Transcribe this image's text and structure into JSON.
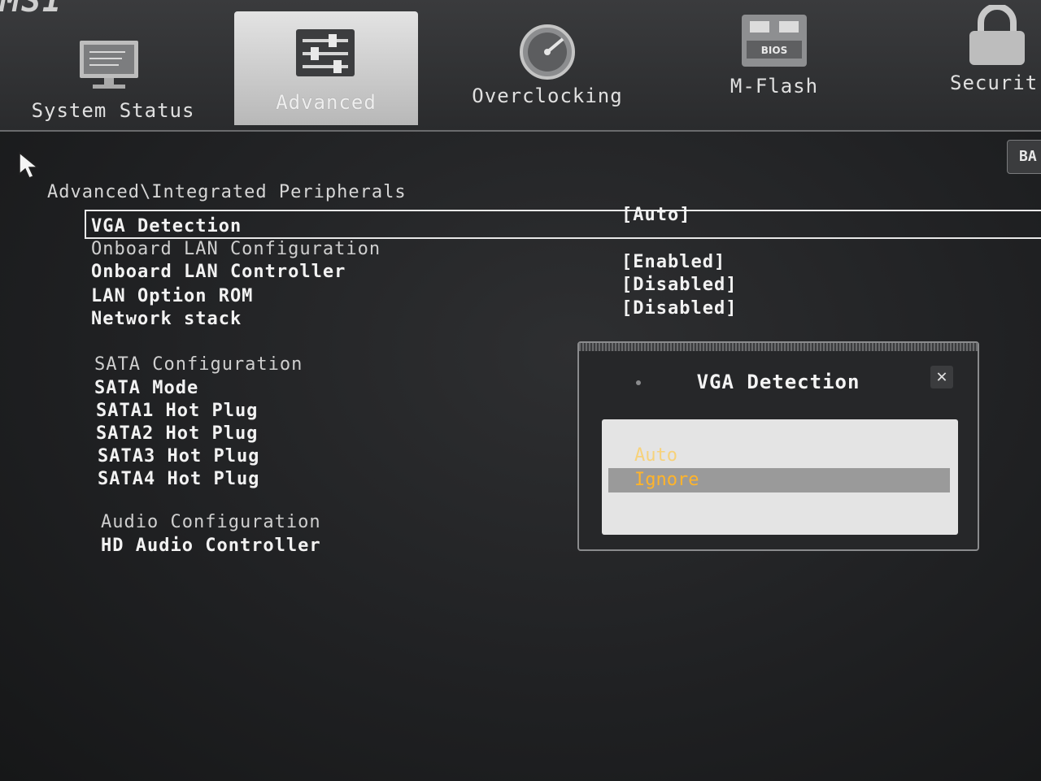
{
  "brand": "MSI",
  "tabs": [
    {
      "label": "System Status",
      "icon": "monitor-icon",
      "active": false
    },
    {
      "label": "Advanced",
      "icon": "sliders-icon",
      "active": true
    },
    {
      "label": "Overclocking",
      "icon": "speedometer-icon",
      "active": false
    },
    {
      "label": "M-Flash",
      "icon": "bios-chip-icon",
      "icon_text": "BIOS",
      "active": false
    },
    {
      "label": "Securit",
      "icon": "padlock-icon",
      "active": false
    }
  ],
  "back_button": {
    "label": "BA"
  },
  "breadcrumb": "Advanced\\Integrated Peripherals",
  "settings": [
    {
      "label": "VGA Detection",
      "value": "[Auto]",
      "type": "item",
      "selected": true
    },
    {
      "label": "Onboard LAN Configuration",
      "type": "sub"
    },
    {
      "label": "Onboard LAN Controller",
      "value": "[Enabled]",
      "type": "item"
    },
    {
      "label": "LAN Option ROM",
      "value": "[Disabled]",
      "type": "item"
    },
    {
      "label": "Network stack",
      "value": "[Disabled]",
      "type": "item"
    },
    {
      "label": "SATA Configuration",
      "type": "sub"
    },
    {
      "label": "SATA Mode",
      "type": "item"
    },
    {
      "label": "SATA1 Hot Plug",
      "type": "item"
    },
    {
      "label": "SATA2 Hot Plug",
      "type": "item"
    },
    {
      "label": "SATA3 Hot Plug",
      "type": "item"
    },
    {
      "label": "SATA4 Hot Plug",
      "type": "item"
    },
    {
      "label": "Audio Configuration",
      "type": "sub"
    },
    {
      "label": "HD Audio Controller",
      "type": "item"
    }
  ],
  "dialog": {
    "title": "VGA Detection",
    "close_icon": "close-icon",
    "options": [
      {
        "label": "Auto",
        "highlighted": false
      },
      {
        "label": "Ignore",
        "highlighted": true
      }
    ]
  },
  "colors": {
    "option_text": "#f0b020",
    "highlight_bg": "#9a9a9a"
  }
}
